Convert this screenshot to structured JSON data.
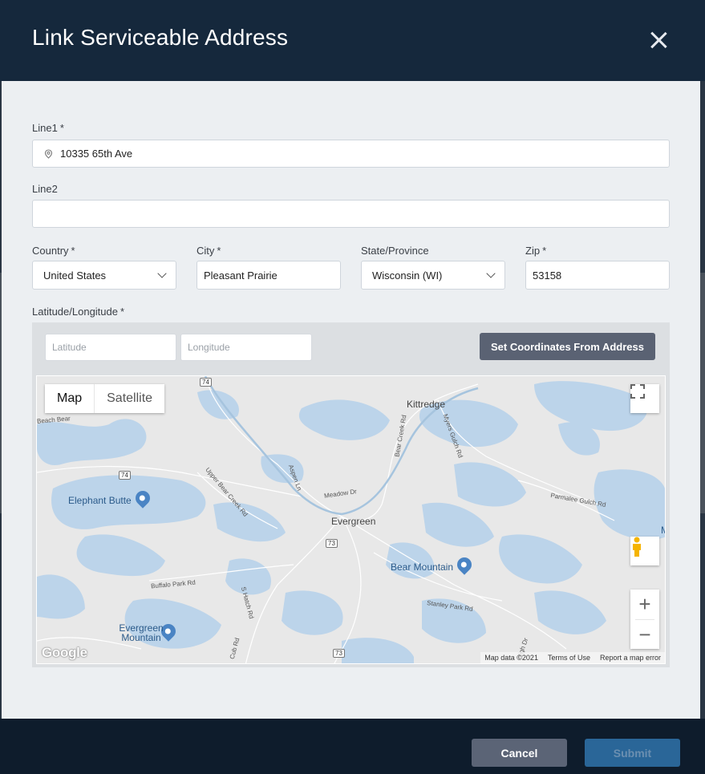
{
  "modal": {
    "title": "Link Serviceable Address"
  },
  "form": {
    "line1": {
      "label": "Line1",
      "required": "*",
      "value": "10335 65th Ave"
    },
    "line2": {
      "label": "Line2",
      "value": ""
    },
    "country": {
      "label": "Country",
      "required": "*",
      "value": "United States"
    },
    "city": {
      "label": "City",
      "required": "*",
      "value": "Pleasant Prairie"
    },
    "state": {
      "label": "State/Province",
      "value": "Wisconsin (WI)"
    },
    "zip": {
      "label": "Zip",
      "required": "*",
      "value": "53158"
    },
    "latlng": {
      "label": "Latitude/Longitude",
      "required": "*",
      "lat_placeholder": "Latitude",
      "lng_placeholder": "Longitude",
      "set_button": "Set Coordinates From Address"
    }
  },
  "map": {
    "type_map": "Map",
    "type_satellite": "Satellite",
    "places": [
      "Elephant Butte",
      "Evergreen",
      "Bear Mountain",
      "Kittredge",
      "Evergreen Mountain"
    ],
    "roads": [
      "Bear Creek Rd",
      "Myers Gulch Rd",
      "Meadow Dr",
      "Aspen Ln",
      "Upper Bear Creek Rd",
      "Parmalee Gulch Rd",
      "Buffalo Park Rd",
      "Stanley Park Rd",
      "S Hatch Rd",
      "Cub Rd",
      "High Dr",
      "Beach Bear"
    ],
    "shields": [
      "74",
      "74",
      "73",
      "73"
    ],
    "footer": {
      "data": "Map data ©2021",
      "terms": "Terms of Use",
      "report": "Report a map error"
    },
    "logo": "Google",
    "edge_letter": "M"
  },
  "footer": {
    "cancel": "Cancel",
    "submit": "Submit"
  },
  "icons": {
    "close": "close-icon",
    "pin": "location-pin-icon",
    "fullscreen": "fullscreen-icon",
    "pegman": "pegman-icon",
    "zoom_in": "plus-icon",
    "zoom_out": "minus-icon"
  }
}
